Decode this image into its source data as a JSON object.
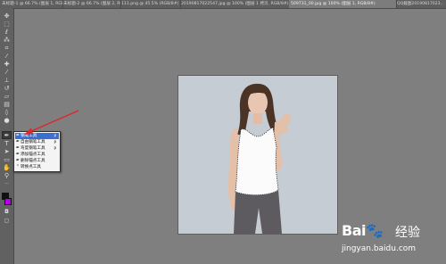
{
  "tabs": [
    {
      "label": "未标题-1 @ 66.7% (图层 1, RGB/8#)"
    },
    {
      "label": "未标题-2 @ 66.7% (图层 2, RGB/8#)"
    },
    {
      "label": "111.png @ 45.5% (RGB/8#)"
    },
    {
      "label": "20190817022547.jpg @ 100% (图层 1 拷贝, RGB/8#)"
    },
    {
      "label": "509731_00.jpg @ 100% (图层 1, RGB/8#)"
    },
    {
      "label": "QQ截图20190817023..."
    }
  ],
  "active_tab_index": 4,
  "toolbar": {
    "tools": [
      "move-icon",
      "marquee-icon",
      "lasso-icon",
      "quick-select-icon",
      "crop-icon",
      "eyedropper-icon",
      "healing-icon",
      "brush-icon",
      "stamp-icon",
      "history-brush-icon",
      "eraser-icon",
      "gradient-icon",
      "blur-icon",
      "dodge-icon",
      "pen-icon",
      "type-icon",
      "path-select-icon",
      "shape-icon",
      "hand-icon",
      "zoom-icon"
    ],
    "selected_tool": "pen-icon",
    "foreground_color": "#111111",
    "background_color": "#b400e6"
  },
  "flyout": {
    "items": [
      {
        "label": "钢笔工具",
        "shortcut": "P",
        "icon": "✒"
      },
      {
        "label": "自由钢笔工具",
        "shortcut": "P",
        "icon": "✒"
      },
      {
        "label": "弯度钢笔工具",
        "shortcut": "P",
        "icon": "✒"
      },
      {
        "label": "添加锚点工具",
        "shortcut": "",
        "icon": "✒"
      },
      {
        "label": "删除锚点工具",
        "shortcut": "",
        "icon": "✒"
      },
      {
        "label": "转换点工具",
        "shortcut": "",
        "icon": "⌃"
      }
    ],
    "highlighted_index": 0
  },
  "colors": {
    "annotation_arrow": "#e0262a",
    "canvas_background": "#c7ccd3",
    "app_background": "#7f7f7f"
  },
  "watermark": {
    "brand_left": "Bai",
    "brand_right": "经验",
    "url": "jingyan.baidu.com"
  }
}
